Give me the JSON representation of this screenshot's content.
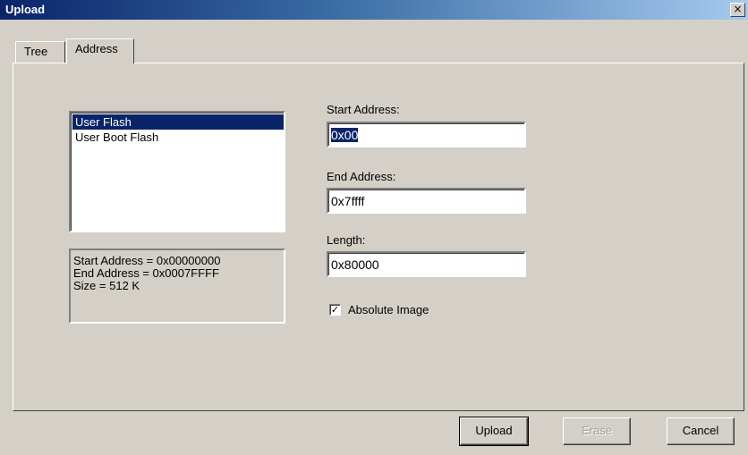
{
  "window": {
    "title": "Upload",
    "close_glyph": "×"
  },
  "tabs": [
    {
      "label": "Tree",
      "active": false
    },
    {
      "label": "Address",
      "active": true
    }
  ],
  "memory_list": {
    "items": [
      {
        "label": "User Flash",
        "selected": true
      },
      {
        "label": "User Boot Flash",
        "selected": false
      }
    ]
  },
  "info": {
    "lines": [
      "Start Address = 0x00000000",
      "End Address = 0x0007FFFF",
      "Size = 512 K"
    ]
  },
  "fields": {
    "start_address": {
      "label": "Start Address:",
      "value": "0x00"
    },
    "end_address": {
      "label": "End Address:",
      "value": "0x7ffff"
    },
    "length": {
      "label": "Length:",
      "value": "0x80000"
    }
  },
  "absolute_image": {
    "label": "Absolute Image",
    "checked": true,
    "check_glyph": "✓"
  },
  "buttons": {
    "upload": "Upload",
    "erase": "Erase",
    "cancel": "Cancel"
  },
  "colors": {
    "face": "#d4d0c8",
    "selection": "#0a246a",
    "title_start": "#0a246a",
    "title_end": "#a6caf0"
  }
}
